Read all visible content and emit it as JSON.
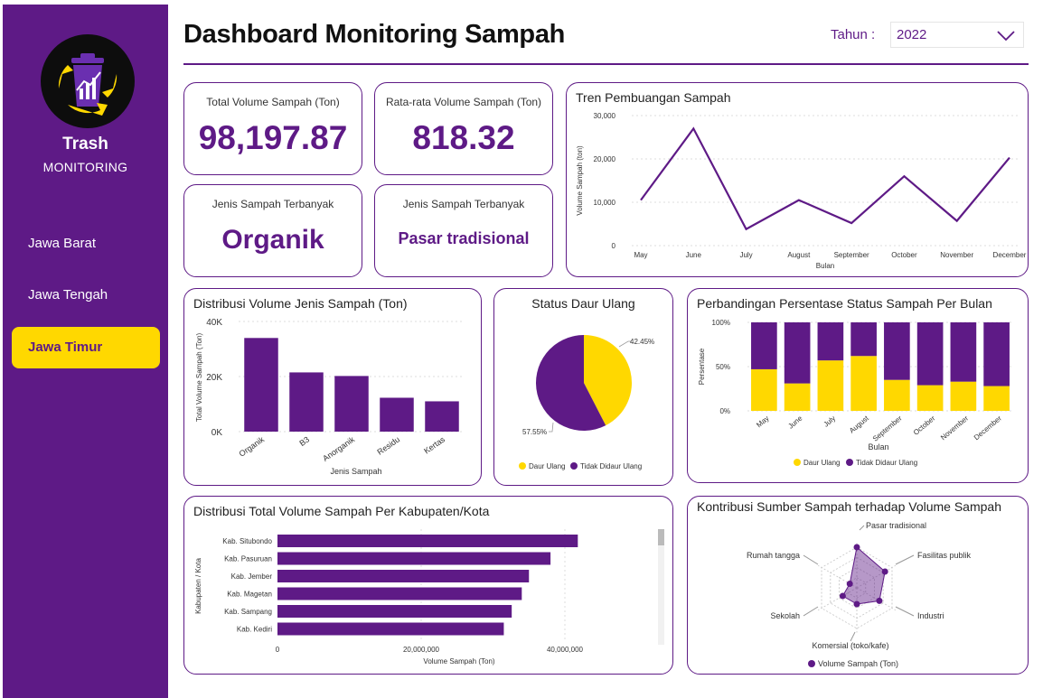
{
  "sidebar": {
    "brand_title": "Trash",
    "brand_subtitle": "MONITORING",
    "nav": [
      {
        "label": "Jawa Barat"
      },
      {
        "label": "Jawa Tengah"
      },
      {
        "label": "Jawa Timur",
        "active": true
      }
    ]
  },
  "header": {
    "title": "Dashboard Monitoring Sampah",
    "year_label": "Tahun :",
    "year_value": "2022"
  },
  "kpis": {
    "total_volume": {
      "label": "Total Volume Sampah (Ton)",
      "value": "98,197.87"
    },
    "avg_volume": {
      "label": "Rata-rata Volume Sampah (Ton)",
      "value": "818.32"
    },
    "top_type": {
      "label": "Jenis Sampah Terbanyak",
      "value": "Organik"
    },
    "top_source": {
      "label": "Jenis Sampah Terbanyak",
      "value": "Pasar tradisional"
    }
  },
  "colors": {
    "primary": "#5e1a86",
    "accent": "#ffd800",
    "background": "#ffffff"
  },
  "chart_data": [
    {
      "id": "trend",
      "type": "line",
      "title": "Tren Pembuangan Sampah",
      "xlabel": "Bulan",
      "ylabel": "Volume Sampah (ton)",
      "categories": [
        "May",
        "June",
        "July",
        "August",
        "September",
        "October",
        "November",
        "December"
      ],
      "values": [
        10500,
        27000,
        3800,
        10500,
        5200,
        16000,
        5700,
        20300
      ],
      "yticks": [
        "0",
        "10,000",
        "20,000",
        "30,000"
      ],
      "ylim": [
        0,
        30000
      ],
      "grid": true
    },
    {
      "id": "type_dist",
      "type": "bar",
      "title": "Distribusi Volume Jenis Sampah (Ton)",
      "xlabel": "Jenis Sampah",
      "ylabel": "Total Volume Sampah (Ton)",
      "categories": [
        "Organik",
        "B3",
        "Anorganik",
        "Residu",
        "Kertas"
      ],
      "values": [
        34000,
        21500,
        20200,
        12300,
        11000
      ],
      "yticks": [
        "0K",
        "20K",
        "40K"
      ],
      "ylim": [
        0,
        40000
      ]
    },
    {
      "id": "recycle",
      "type": "pie",
      "title": "Status Daur Ulang",
      "slices": [
        {
          "name": "Daur Ulang",
          "value": 42.45,
          "label": "42.45%"
        },
        {
          "name": "Tidak Didaur Ulang",
          "value": 57.55,
          "label": "57.55%"
        }
      ],
      "legend": "bottom"
    },
    {
      "id": "status_pct",
      "type": "bar",
      "stacked": true,
      "title": "Perbandingan Persentase Status Sampah Per Bulan",
      "xlabel": "Bulan",
      "ylabel": "Persentase",
      "categories": [
        "May",
        "June",
        "July",
        "August",
        "September",
        "October",
        "November",
        "December"
      ],
      "series": [
        {
          "name": "Daur Ulang",
          "values": [
            47,
            31,
            57,
            62,
            35,
            29,
            33,
            28
          ]
        },
        {
          "name": "Tidak Didaur Ulang",
          "values": [
            53,
            69,
            43,
            38,
            65,
            71,
            67,
            72
          ]
        }
      ],
      "yticks": [
        "0%",
        "50%",
        "100%"
      ],
      "ylim": [
        0,
        100
      ],
      "legend": "bottom"
    },
    {
      "id": "kab_dist",
      "type": "bar",
      "orientation": "horizontal",
      "title": "Distribusi Total Volume Sampah Per Kabupaten/Kota",
      "xlabel": "Volume Sampah (Ton)",
      "ylabel": "Kabupaten / Kota",
      "categories": [
        "Kab. Situbondo",
        "Kab. Pasuruan",
        "Kab. Jember",
        "Kab. Magetan",
        "Kab. Sampang",
        "Kab. Kediri"
      ],
      "values": [
        41800000,
        38000000,
        35000000,
        34000000,
        32600000,
        31500000
      ],
      "xticks": [
        "0",
        "20,000,000",
        "40,000,000"
      ],
      "xlim": [
        0,
        40000000
      ]
    },
    {
      "id": "source_radar",
      "type": "radar",
      "title": "Kontribusi Sumber Sampah terhadap Volume Sampah",
      "categories": [
        "Pasar tradisional",
        "Fasilitas publik",
        "Industri",
        "Komersial (toko/kafe)",
        "Sekolah",
        "Rumah tangga"
      ],
      "values": [
        25,
        20,
        16,
        10,
        10,
        5
      ],
      "max": 25,
      "legend": "bottom",
      "series_name": "Volume Sampah (Ton)"
    }
  ]
}
